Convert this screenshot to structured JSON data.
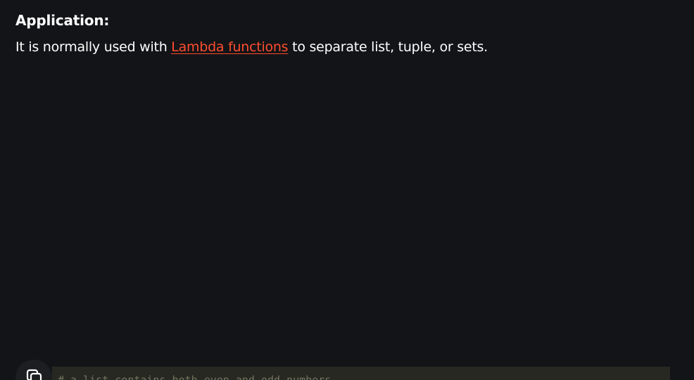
{
  "section": {
    "heading": "Application:",
    "text_before": "It is normally used with ",
    "link_text": "Lambda functions",
    "text_after": " to separate list, tuple, or sets."
  },
  "code": {
    "comment_line": "# a list contains both even and odd numbers."
  },
  "icons": {
    "copy": "copy-icon"
  },
  "colors": {
    "background": "#131417",
    "link": "#ff4d2e",
    "code_background": "#272822",
    "code_comment": "#75715e"
  }
}
